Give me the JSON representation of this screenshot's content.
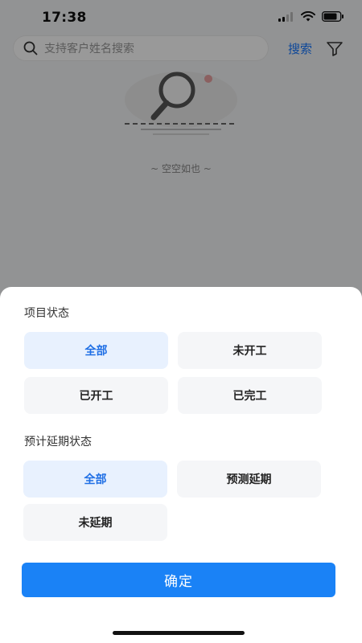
{
  "status_bar": {
    "time": "17:38"
  },
  "search": {
    "placeholder": "支持客户姓名搜索",
    "button_label": "搜索"
  },
  "empty_state": {
    "text": "~ 空空如也 ~"
  },
  "filter_sheet": {
    "project_status": {
      "title": "项目状态",
      "options": [
        "全部",
        "未开工",
        "已开工",
        "已完工"
      ],
      "selected": "全部"
    },
    "delay_status": {
      "title": "预计延期状态",
      "options": [
        "全部",
        "预测延期",
        "未延期"
      ],
      "selected": "全部"
    },
    "confirm_label": "确定"
  },
  "colors": {
    "accent": "#1a82f6",
    "selected_bg": "#e8f1fe",
    "selected_text": "#1f6fe5"
  }
}
